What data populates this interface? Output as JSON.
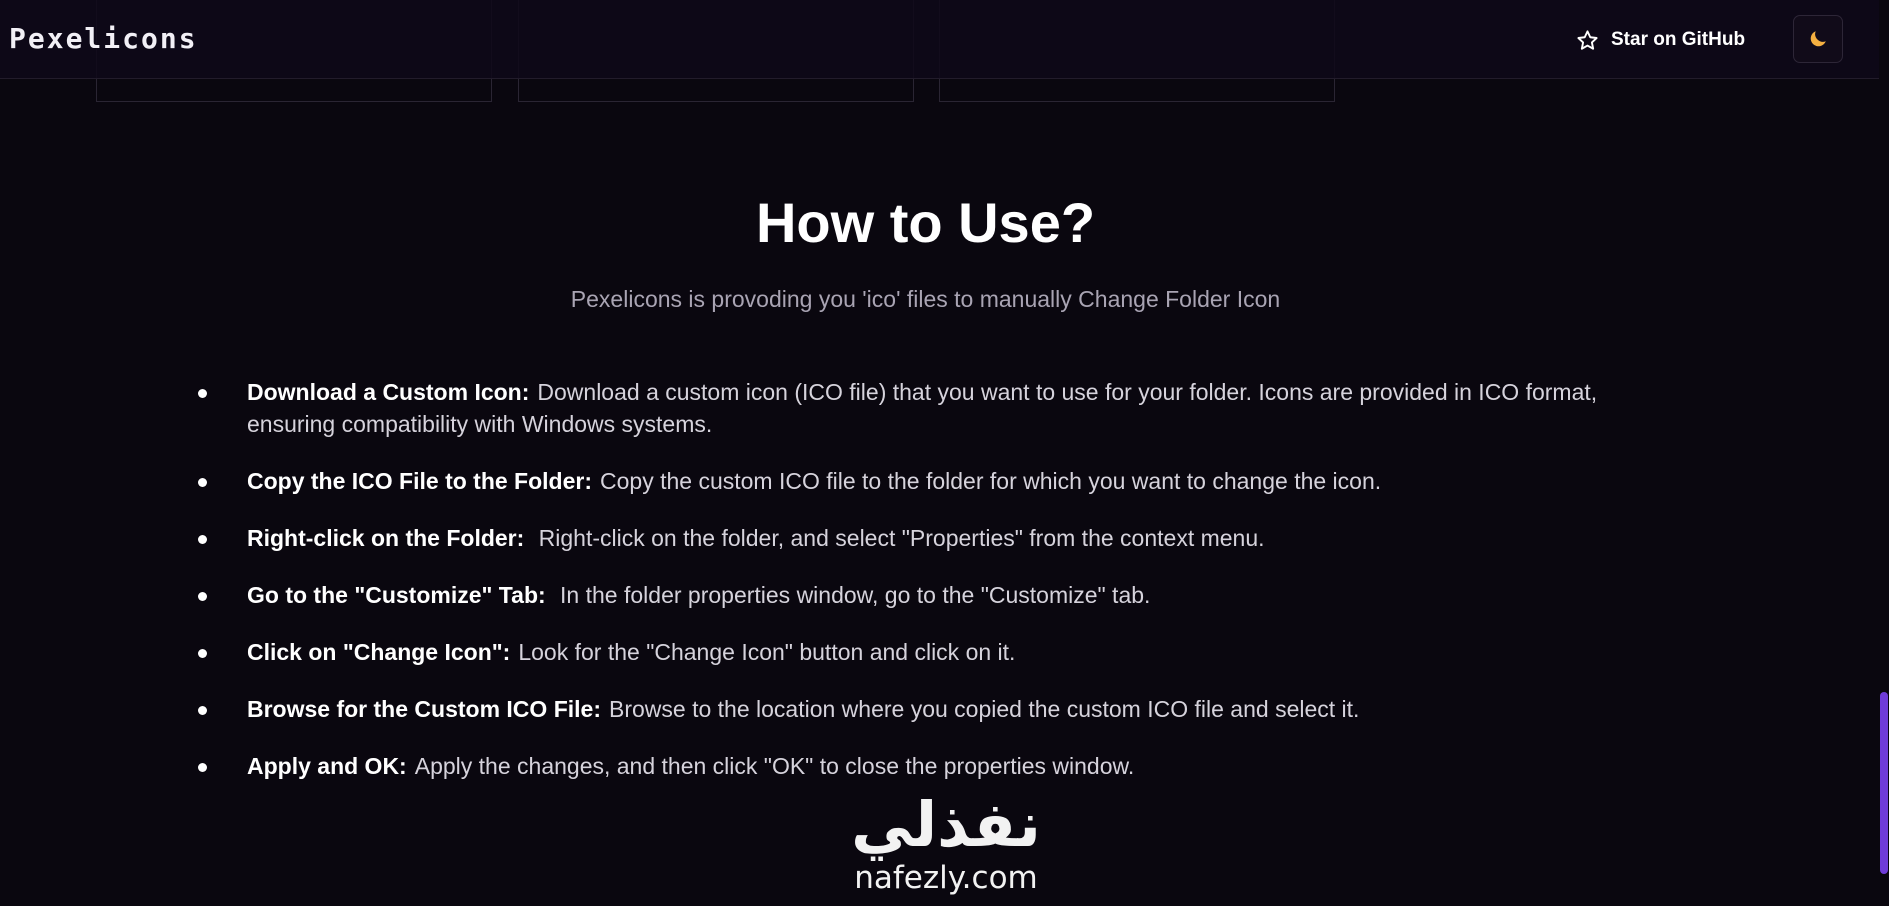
{
  "header": {
    "logo": "Pexelicons",
    "star_label": "Star on GitHub",
    "star_icon": "star-outline-icon",
    "theme_icon": "moon-icon",
    "theme_icon_color": "#f5b041"
  },
  "section": {
    "title": "How to Use?",
    "subtitle": "Pexelicons is provoding you 'ico' files to manually Change Folder Icon",
    "steps": [
      {
        "heading": "Download a Custom Icon:",
        "text": "Download a custom icon (ICO file) that you want to use for your folder. Icons are provided in ICO format, ensuring compatibility with Windows systems."
      },
      {
        "heading": "Copy the ICO File to the Folder:",
        "text": "Copy the custom ICO file to the folder for which you want to change the icon."
      },
      {
        "heading": "Right-click on the Folder:",
        "text": " Right-click on the folder, and select \"Properties\" from the context menu."
      },
      {
        "heading": "Go to the \"Customize\" Tab:",
        "text": " In the folder properties window, go to the \"Customize\" tab."
      },
      {
        "heading": "Click on \"Change Icon\":",
        "text": "Look for the \"Change Icon\" button and click on it."
      },
      {
        "heading": "Browse for the Custom ICO File:",
        "text": "Browse to the location where you copied the custom ICO file and select it."
      },
      {
        "heading": "Apply and OK:",
        "text": "Apply the changes, and then click \"OK\" to close the properties window."
      }
    ]
  },
  "watermark": {
    "arabic": "نفذلي",
    "latin": "nafezly.com"
  },
  "colors": {
    "background": "#0a070f",
    "accent": "#6f3cd8"
  }
}
